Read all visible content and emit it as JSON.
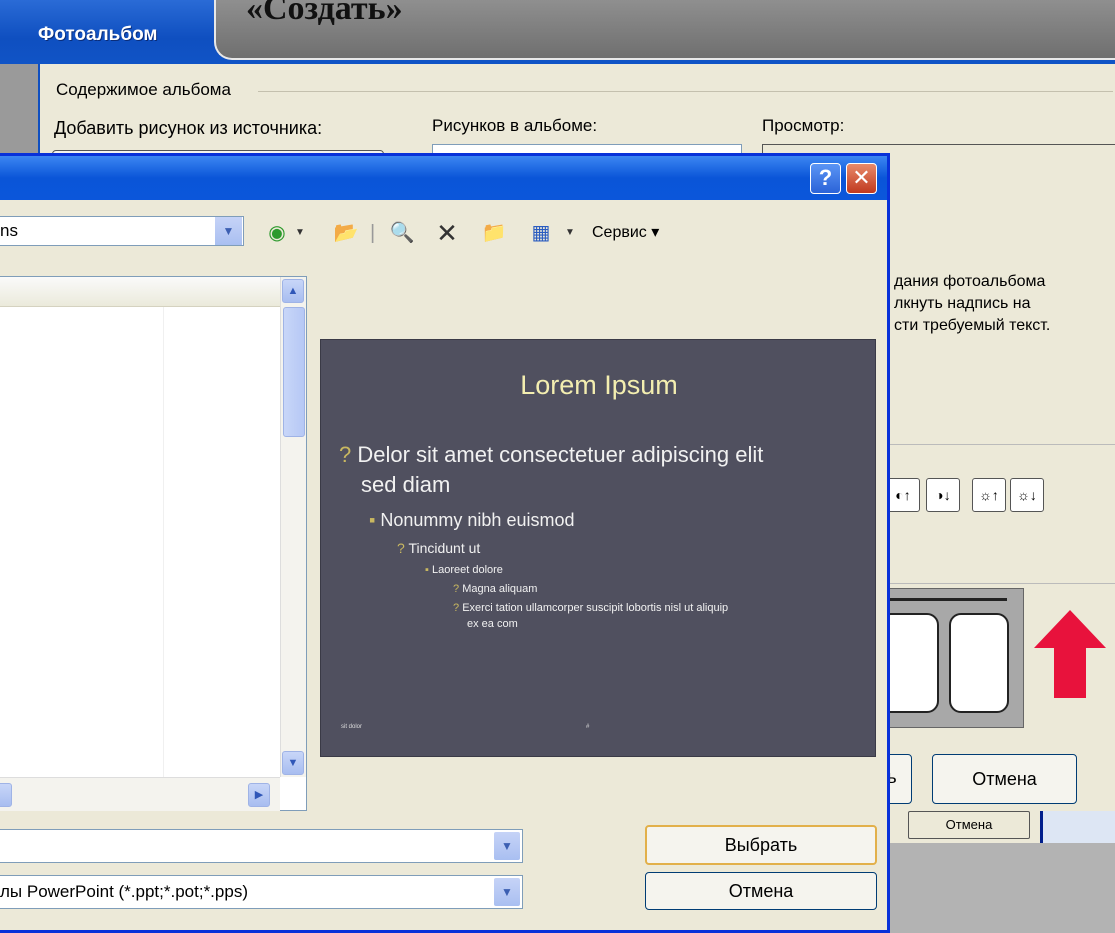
{
  "banner": {
    "text": "«Создать»"
  },
  "album_dialog": {
    "title": "Фотоальбом",
    "group_label": "Содержимое альбома",
    "add_picture_label": "Добавить рисунок из источника:",
    "pictures_label": "Рисунков в альбоме:",
    "preview_label": "Просмотр:",
    "hint_lines": [
      "дания фотоальбома",
      "лкнуть надпись на",
      "сти требуемый текст."
    ],
    "ok_label": "ть",
    "cancel_label": "Отмена",
    "cancel_small_label": "Отмена"
  },
  "file_dialog": {
    "location_value": "ns",
    "toolbar": {
      "service_label": "Сервис ▾"
    },
    "filename_value": "",
    "filetype_value": "лы PowerPoint (*.ppt;*.pot;*.pps)",
    "select_label": "Выбрать",
    "cancel_label": "Отмена",
    "help_label": "?",
    "close_label": "✕"
  },
  "preview_slide": {
    "title": "Lorem Ipsum",
    "lines": [
      "Delor sit amet consectetuer adipiscing elit",
      "sed diam",
      "Nonummy nibh euismod",
      "Tincidunt ut",
      "Laoreet dolore",
      "Magna aliquam",
      "Exerci tation ullamcorper suscipit lobortis nisl ut aliquip",
      "ex ea com"
    ],
    "footer_left": "sit dolor",
    "footer_right": "#"
  },
  "colors": {
    "titlebar": "#0a55d8",
    "dialog_bg": "#ece9d8",
    "slide_bg": "#50505f",
    "slide_title": "#f3eeb0",
    "arrow": "#e8123c"
  }
}
